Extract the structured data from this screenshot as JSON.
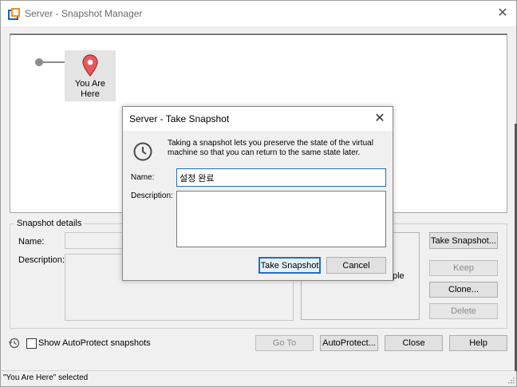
{
  "window": {
    "title": "Server - Snapshot Manager",
    "close_glyph": "✕"
  },
  "tree": {
    "current_node_label_line1": "You Are",
    "current_node_label_line2": "Here"
  },
  "details": {
    "group_label": "Snapshot details",
    "name_label": "Name:",
    "description_label": "Description:",
    "panel_partial_text": "ple"
  },
  "side_buttons": {
    "take_snapshot": "Take Snapshot...",
    "keep": "Keep",
    "clone": "Clone...",
    "delete": "Delete"
  },
  "bottom": {
    "autoprotect_checkbox_label": "Show AutoProtect snapshots",
    "autoprotect_checked": false,
    "go_to": "Go To",
    "autoprotect": "AutoProtect...",
    "close": "Close",
    "help": "Help"
  },
  "status": {
    "text": "\"You Are Here\" selected"
  },
  "dialog": {
    "title": "Server - Take Snapshot",
    "close_glyph": "✕",
    "info_line1": "Taking a snapshot lets you preserve the state of the virtual",
    "info_line2": "machine so that you can return to the same state later.",
    "name_label": "Name:",
    "name_value": "설정 완료",
    "description_label": "Description:",
    "description_value": "",
    "take_snapshot_button": "Take Snapshot",
    "cancel_button": "Cancel"
  },
  "colors": {
    "accent_blue": "#1f6fc5",
    "pin_red": "#e85a5a",
    "app_icon_orange": "#f28c28"
  },
  "icons": {
    "app": "vmware-icon",
    "pin": "location-pin-icon",
    "clock": "clock-icon",
    "history": "history-icon",
    "grip": "resize-grip-icon"
  }
}
